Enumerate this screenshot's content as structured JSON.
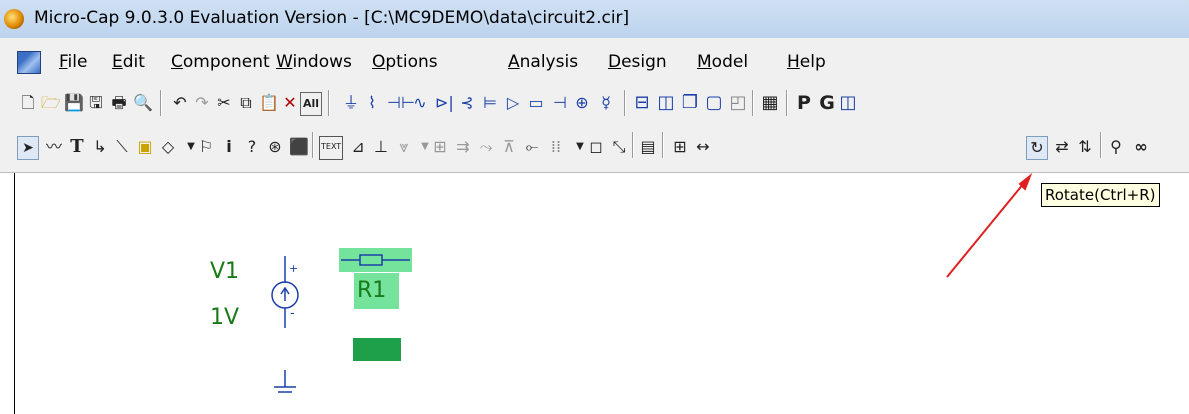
{
  "window": {
    "title": "Micro-Cap 9.0.3.0 Evaluation Version - [C:\\MC9DEMO\\data\\circuit2.cir]"
  },
  "menu": [
    {
      "u": "F",
      "rest": "ile"
    },
    {
      "u": "E",
      "rest": "dit"
    },
    {
      "u": "C",
      "rest": "omponent"
    },
    {
      "u": "W",
      "rest": "indows"
    },
    {
      "u": "O",
      "rest": "ptions"
    },
    {
      "u": "A",
      "rest": "nalysis"
    },
    {
      "u": "D",
      "rest": "esign"
    },
    {
      "u": "M",
      "rest": "odel"
    },
    {
      "u": "H",
      "rest": "elp"
    }
  ],
  "toolbar": {
    "all_label": "All",
    "p_label": "P",
    "g_label": "G",
    "text_label": "TEXT"
  },
  "tooltip": "Rotate(Ctrl+R)",
  "circuit": {
    "v1_name": "V1",
    "v1_value": "1V",
    "r1_name": "R1",
    "plus": "+",
    "minus": "-"
  },
  "colors": {
    "component": "#1a7a1a",
    "wire": "#1b3fa8",
    "selection": "#74e39c",
    "arrow": "#e02020"
  }
}
